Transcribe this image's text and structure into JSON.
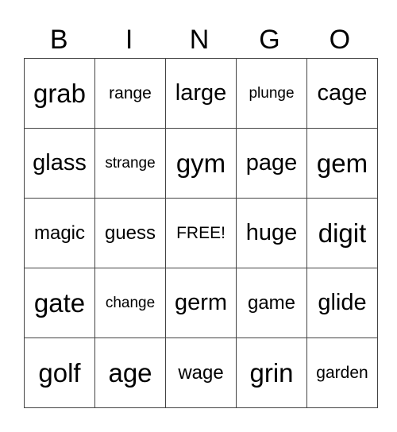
{
  "header": [
    "B",
    "I",
    "N",
    "G",
    "O"
  ],
  "rows": [
    [
      "grab",
      "range",
      "large",
      "plunge",
      "cage"
    ],
    [
      "glass",
      "strange",
      "gym",
      "page",
      "gem"
    ],
    [
      "magic",
      "guess",
      "FREE!",
      "huge",
      "digit"
    ],
    [
      "gate",
      "change",
      "germ",
      "game",
      "glide"
    ],
    [
      "golf",
      "age",
      "wage",
      "grin",
      "garden"
    ]
  ]
}
